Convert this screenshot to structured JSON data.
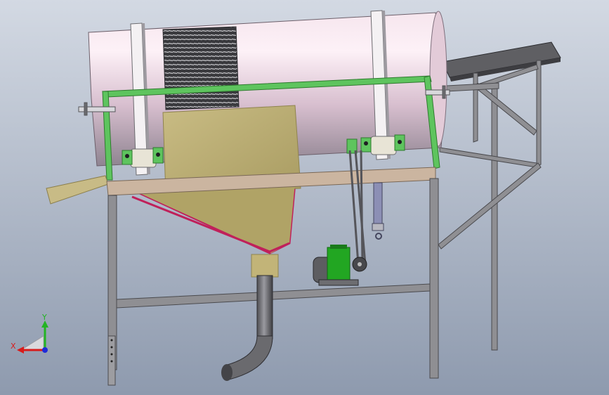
{
  "triad": {
    "x_label": "X",
    "y_label": "Y",
    "x_color": "#d81b1b",
    "y_color": "#23b423",
    "z_color": "#1f2bd8"
  },
  "colors": {
    "background_top": "#d2d8e2",
    "background_bottom": "#8f9bb0",
    "drum_highlight": "#fce8f2",
    "drum_shadow": "#9e8d9a",
    "frame_green": "#5ec45e",
    "hopper_tan": "#c2b478",
    "hopper_outline": "#c0205a",
    "deck_beam": "#c9b39e",
    "steel_gray": "#8f8f93",
    "motor_green": "#22a622"
  }
}
